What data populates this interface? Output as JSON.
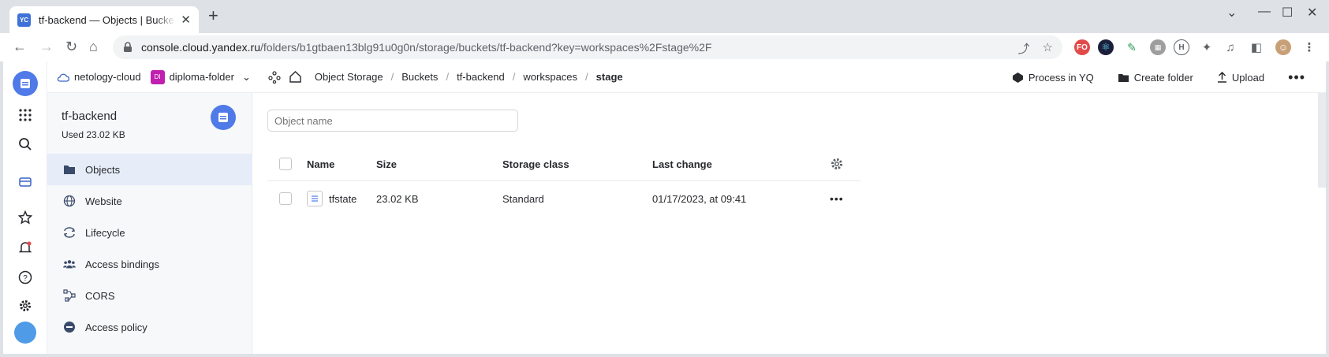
{
  "browser": {
    "tab_favicon": "YC",
    "tab_title": "tf-backend — Objects | Bucke",
    "url_host": "console.cloud.yandex.ru",
    "url_path": "/folders/b1gtbaen13blg91u0g0n/storage/buckets/tf-backend?key=workspaces%2Fstage%2F",
    "ext_badge_1": "FO"
  },
  "header": {
    "cloud": "netology-cloud",
    "folder_badge": "DI",
    "folder": "diploma-folder",
    "breadcrumbs": [
      "Object Storage",
      "Buckets",
      "tf-backend",
      "workspaces",
      "stage"
    ],
    "actions": {
      "process": "Process in YQ",
      "create_folder": "Create folder",
      "upload": "Upload"
    }
  },
  "bucket": {
    "name": "tf-backend",
    "used": "Used 23.02 KB"
  },
  "menu": [
    {
      "label": "Objects",
      "icon": "folder-icon",
      "active": true
    },
    {
      "label": "Website",
      "icon": "globe-icon"
    },
    {
      "label": "Lifecycle",
      "icon": "cycle-icon"
    },
    {
      "label": "Access bindings",
      "icon": "people-icon"
    },
    {
      "label": "CORS",
      "icon": "nodes-icon"
    },
    {
      "label": "Access policy",
      "icon": "no-entry-icon"
    }
  ],
  "search": {
    "placeholder": "Object name"
  },
  "table": {
    "columns": [
      "Name",
      "Size",
      "Storage class",
      "Last change"
    ],
    "rows": [
      {
        "name": "tfstate",
        "size": "23.02 KB",
        "storage_class": "Standard",
        "last_change": "01/17/2023, at 09:41"
      }
    ]
  },
  "colors": {
    "accent": "#4f7ae8",
    "active_bg": "#e6ecf8",
    "folder_badge": "#c01fb0"
  }
}
